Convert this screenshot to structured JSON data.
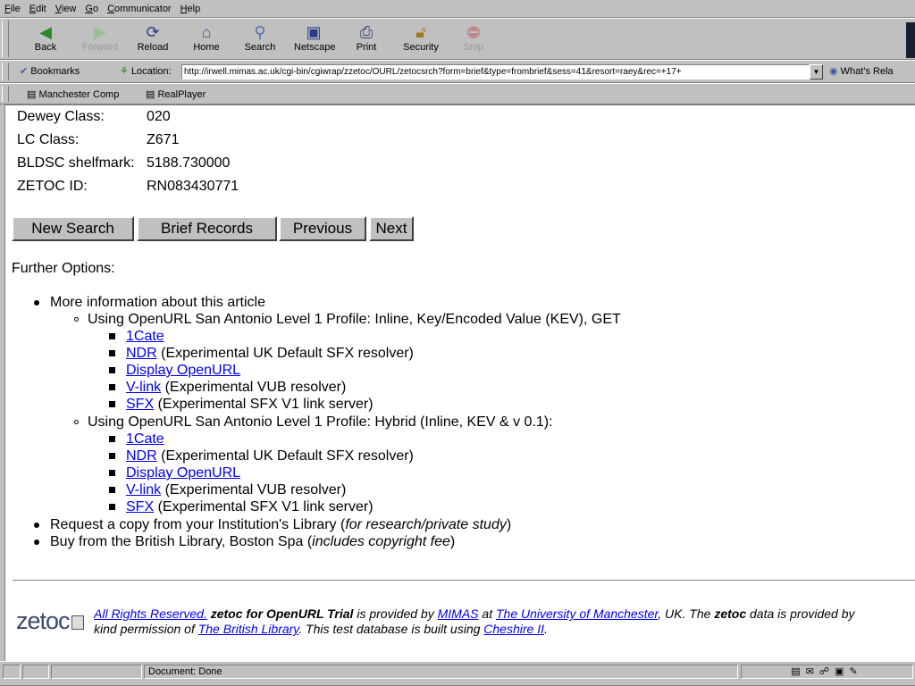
{
  "menu": [
    "File",
    "Edit",
    "View",
    "Go",
    "Communicator",
    "Help"
  ],
  "toolbar": {
    "back": "Back",
    "forward": "Forward",
    "reload": "Reload",
    "home": "Home",
    "search": "Search",
    "netscape": "Netscape",
    "print": "Print",
    "security": "Security",
    "stop": "Stop"
  },
  "location": {
    "bookmarks": "Bookmarks",
    "label": "Location:",
    "url": "http://irwell.mimas.ac.uk/cgi-bin/cgiwrap/zzetoc/OURL/zetocsrch?form=brief&type=frombrief&sess=41&resort=raey&rec=+17+",
    "related": "What's Rela"
  },
  "personal": [
    "Manchester Comp",
    "RealPlayer"
  ],
  "record": [
    {
      "label": "Dewey Class:",
      "value": "020"
    },
    {
      "label": "LC Class:",
      "value": "Z671"
    },
    {
      "label": "BLDSC shelfmark:",
      "value": "5188.730000"
    },
    {
      "label": "ZETOC ID:",
      "value": "RN083430771"
    }
  ],
  "buttons": {
    "new_search": "New Search",
    "brief": "Brief Records",
    "previous": "Previous",
    "next": "Next"
  },
  "further": "Further Options:",
  "more_info": "More information about this article",
  "profile1": "Using OpenURL San Antonio Level 1 Profile: Inline, Key/Encoded Value (KEV), GET",
  "profile2": "Using OpenURL San Antonio Level 1 Profile: Hybrid (Inline, KEV & v 0.1):",
  "links": {
    "cate": "1Cate",
    "ndr": "NDR",
    "ndr_desc": " (Experimental UK Default SFX resolver)",
    "display": "Display OpenURL",
    "vlink": "V-link",
    "vlink_desc": " (Experimental VUB resolver)",
    "sfx": "SFX",
    "sfx_desc": " (Experimental SFX V1 link server)"
  },
  "request": {
    "text": "Request a copy from your Institution's Library (",
    "em": "for research/private study",
    "close": ")"
  },
  "buy": {
    "text": "Buy from the British Library, Boston Spa (",
    "em": "includes copyright fee",
    "close": ")"
  },
  "footer": {
    "logo": "zetoc",
    "rights": "All Rights Reserved.",
    "bold1": "zetoc for OpenURL Trial",
    "t1": " is provided by ",
    "mimas": "MIMAS",
    "t2": " at ",
    "uni": "The University of Manchester",
    "t3": ", UK. The ",
    "bold2": "zetoc",
    "t4": " data is provided by",
    "t5": "kind permission of ",
    "bl": "The British Library",
    "t6": ". This test database is built using ",
    "cheshire": "Cheshire II",
    "t7": "."
  },
  "status": "Document: Done"
}
